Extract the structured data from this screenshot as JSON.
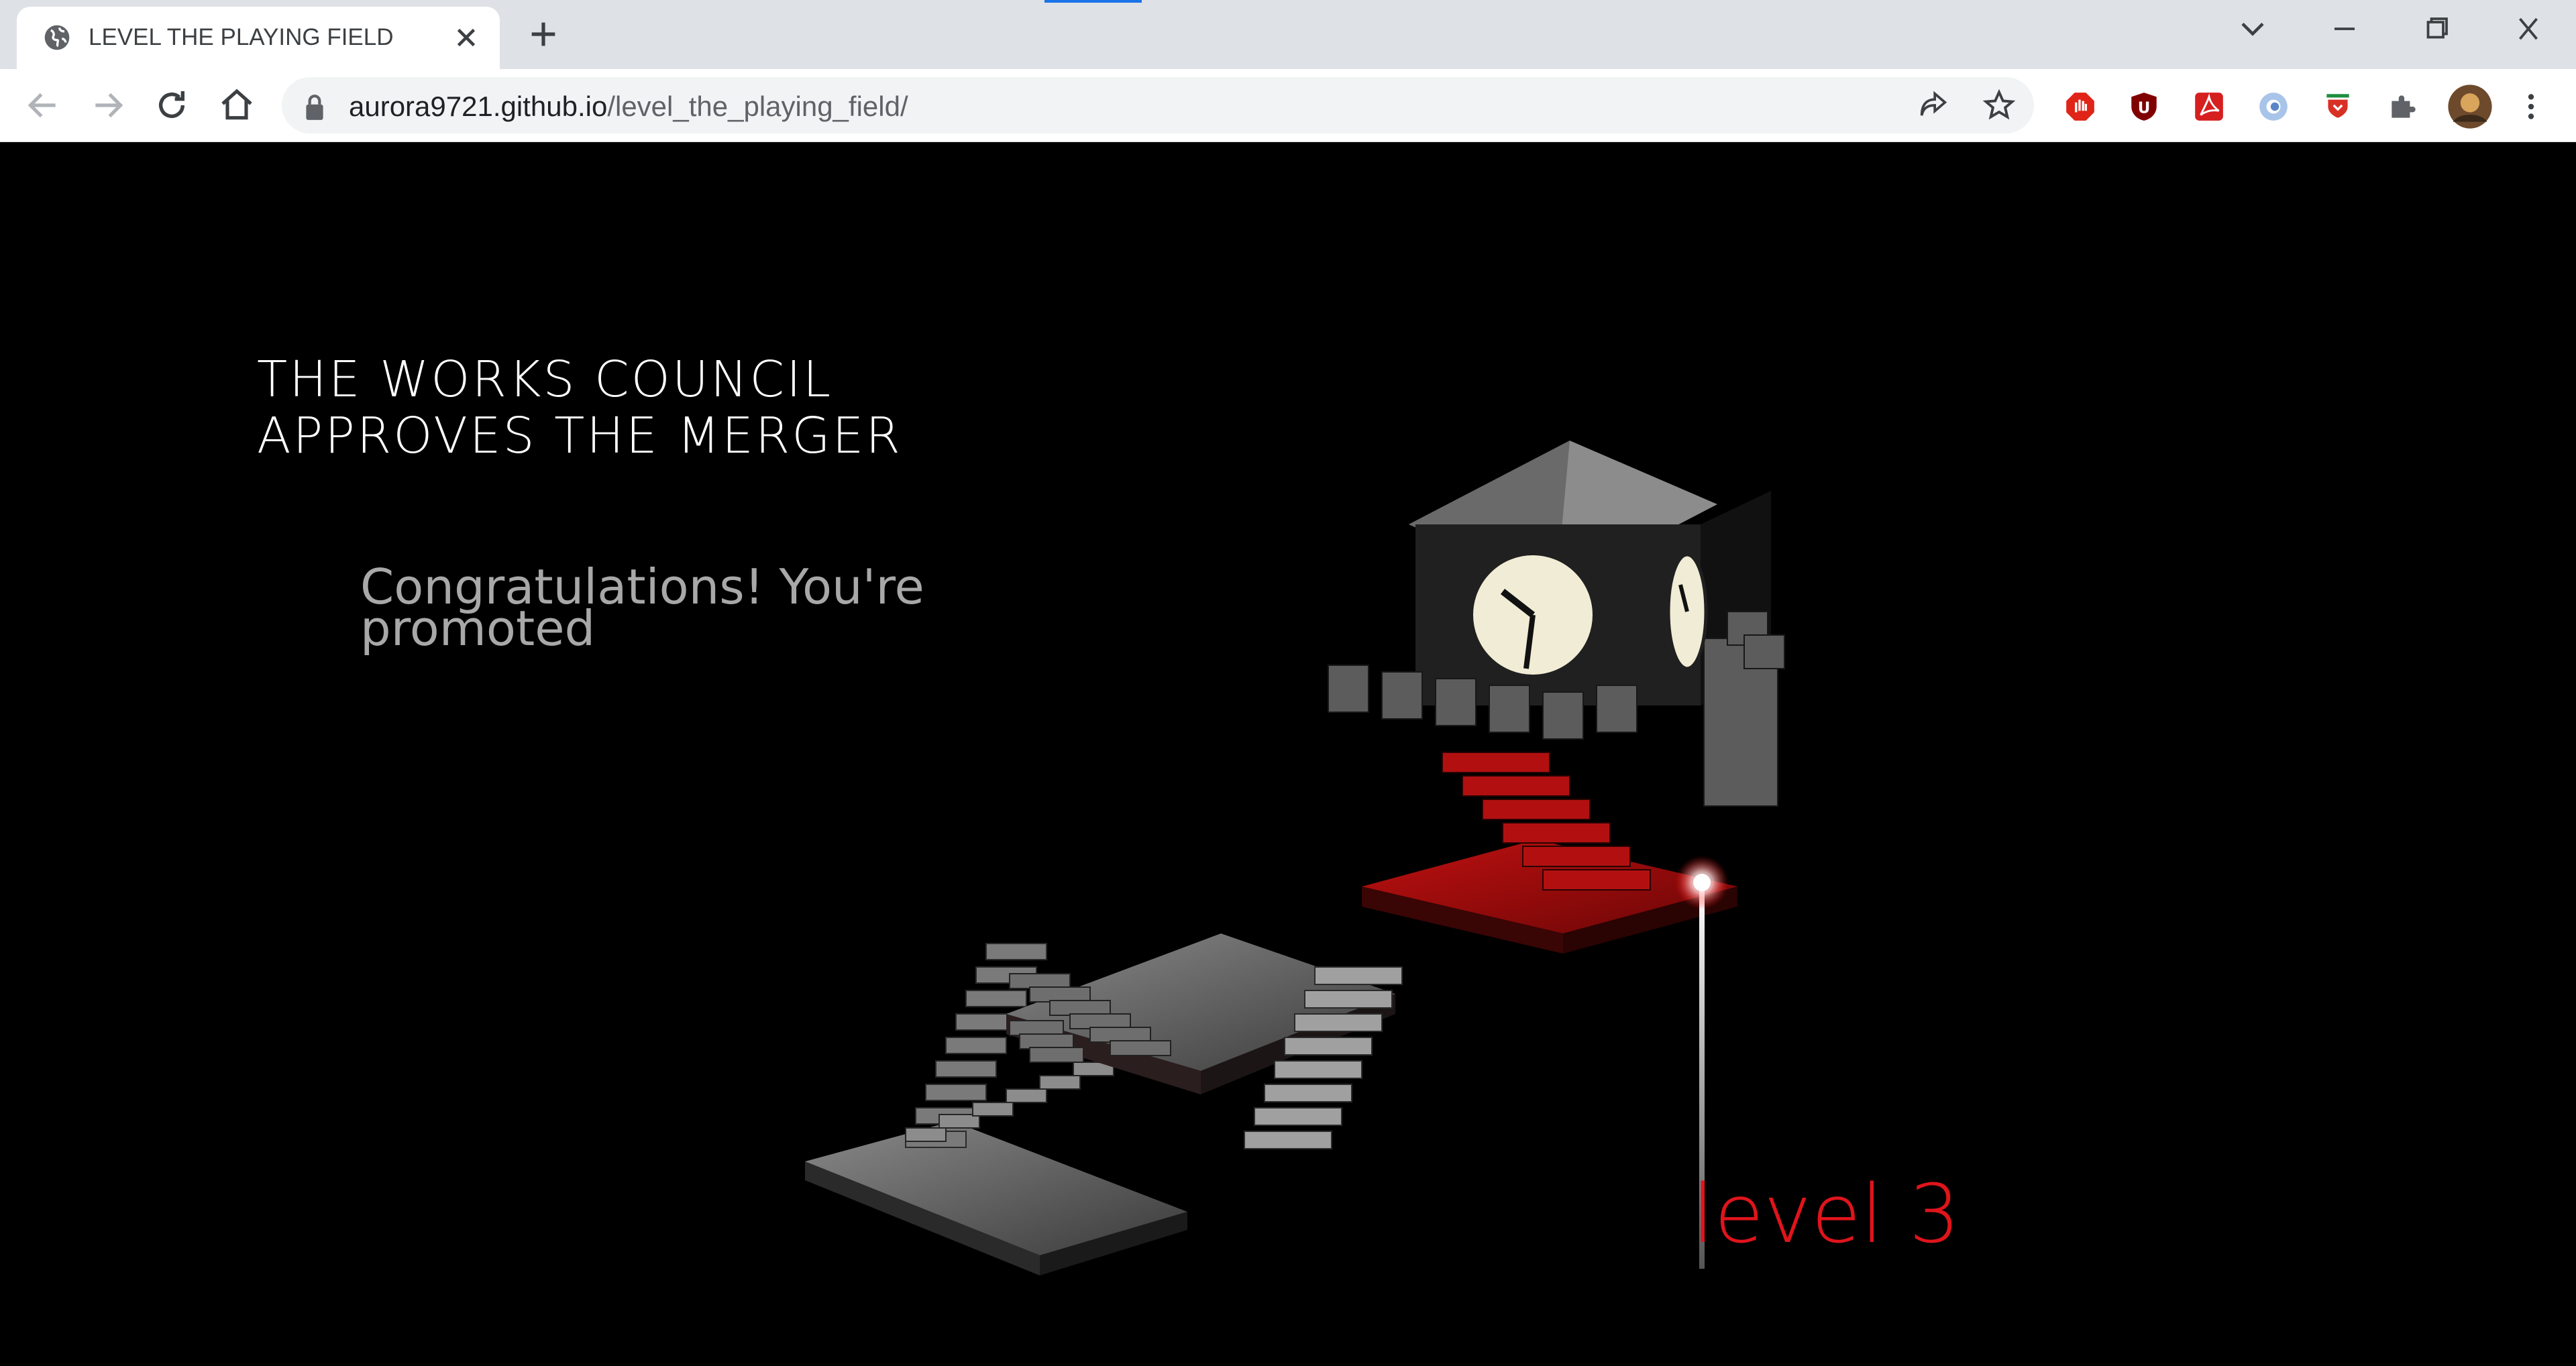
{
  "browser": {
    "tab": {
      "title": "LEVEL THE PLAYING FIELD",
      "favicon": "globe-icon"
    },
    "address": {
      "host": "aurora9721.github.io",
      "path": "/level_the_playing_field/"
    },
    "nav_icons": [
      "back-arrow-icon",
      "forward-arrow-icon",
      "reload-icon",
      "home-icon"
    ],
    "omnibox_icons": [
      "share-icon",
      "star-icon"
    ],
    "extensions": [
      {
        "icon": "stop-hand-icon",
        "color": "#e02418"
      },
      {
        "icon": "ublock-icon",
        "color": "#800000"
      },
      {
        "icon": "acrobat-icon",
        "color": "#d61f1f"
      },
      {
        "icon": "grammar-icon",
        "color": "#a9c4e9"
      },
      {
        "icon": "shield-extension-icon",
        "color": "#d93025"
      },
      {
        "icon": "puzzle-icon",
        "color": "#5f6368"
      }
    ]
  },
  "game": {
    "headline": "THE WORKS COUNCIL APPROVES THE MERGER",
    "message": "Congratulations! You're promoted",
    "level_label": "level 3",
    "accent_color": "#e0141b"
  }
}
